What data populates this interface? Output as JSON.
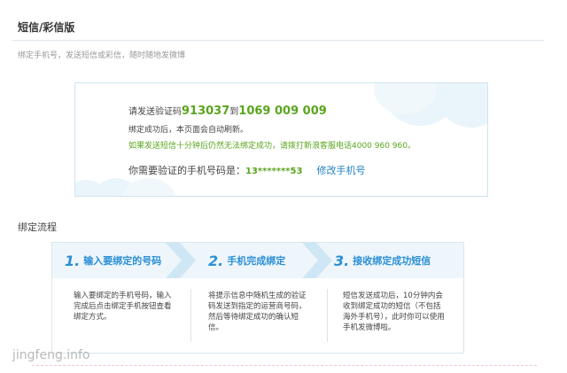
{
  "page": {
    "title": "短信/彩信版",
    "subtitle": "绑定手机号，发送短信或彩信，随时随地发微博"
  },
  "verify": {
    "prefix": "请发送验证码",
    "code": "913037",
    "to": "到",
    "number": "1069 009 009",
    "success_note": "绑定成功后，本页面会自动刷新。",
    "help_note": "如果发送短信十分钟后仍然无法绑定成功，请拨打新浪客服电话4000 960 960。",
    "phone_prefix": "你需要验证的手机号码是：",
    "phone": "13*******53",
    "change_link": "修改手机号"
  },
  "flow": {
    "title": "绑定流程",
    "steps": [
      {
        "num": "1.",
        "label": "输入要绑定的号码",
        "desc": "输入要绑定的手机号码，输入完成后点击绑定手机按钮查看绑定方式。"
      },
      {
        "num": "2.",
        "label": "手机完成绑定",
        "desc": "将提示信息中随机生成的验证码发送到指定的运营商号码，然后等待绑定成功的确认短信。"
      },
      {
        "num": "3.",
        "label": "接收绑定成功短信",
        "desc": "短信发送成功后，10分钟内会收到绑定成功的短信（不包括海外手机号），此时你可以使用手机发微博啦。"
      }
    ]
  },
  "watermark": "jingfeng.info"
}
